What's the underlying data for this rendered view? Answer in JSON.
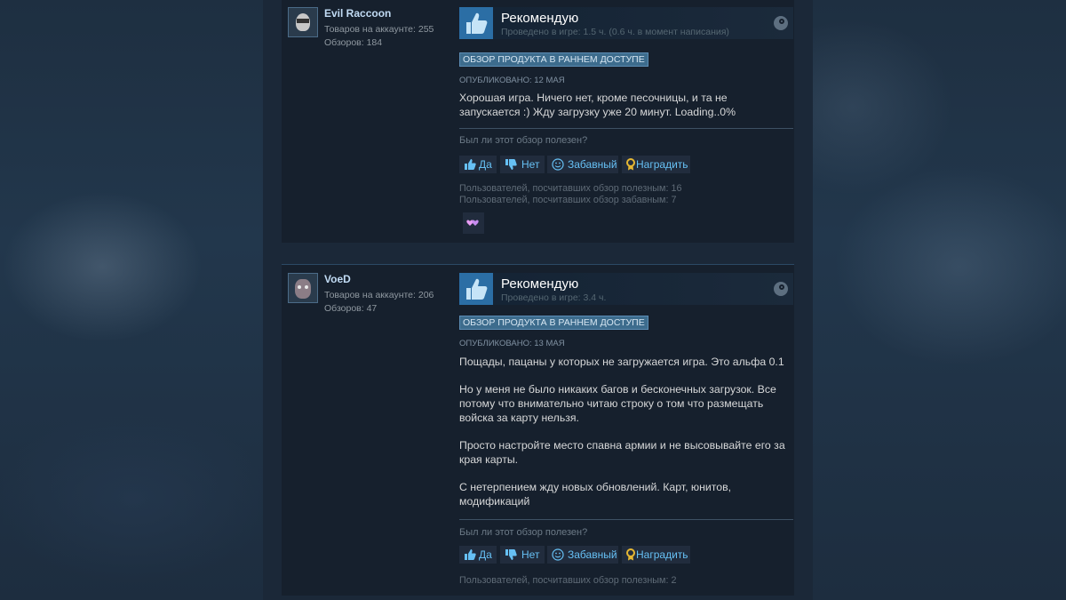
{
  "reviews": [
    {
      "author": {
        "name": "Evil Raccoon",
        "products": "Товаров на аккаунте: 255",
        "reviews": "Обзоров: 184"
      },
      "recommend_label": "Рекомендую",
      "hours": "Проведено в игре: 1.5 ч. (0.6 ч. в момент написания)",
      "badge": "ОБЗОР ПРОДУКТА В РАННЕМ ДОСТУПЕ",
      "posted": "ОПУБЛИКОВАНО: 12 МАЯ",
      "paragraphs": [
        "Хорошая игра. Ничего нет, кроме песочницы, и та не запускается :) Жду загрузку уже 20 минут. Loading..0%"
      ],
      "helpful_question": "Был ли этот обзор полезен?",
      "buttons": {
        "yes": "Да",
        "no": "Нет",
        "funny": "Забавный",
        "award": "Наградить"
      },
      "stats": {
        "helpful": "Пользователей, посчитавших обзор полезным: 16",
        "funny": "Пользователей, посчитавших обзор забавным: 7"
      }
    },
    {
      "author": {
        "name": "VoeD",
        "products": "Товаров на аккаунте: 206",
        "reviews": "Обзоров: 47"
      },
      "recommend_label": "Рекомендую",
      "hours": "Проведено в игре: 3.4 ч.",
      "badge": "ОБЗОР ПРОДУКТА В РАННЕМ ДОСТУПЕ",
      "posted": "ОПУБЛИКОВАНО: 13 МАЯ",
      "paragraphs": [
        "Пощады, пацаны у которых не загружается игра. Это альфа 0.1",
        "Но у меня не было никаких багов и бесконечных загрузок. Все потому что внимательно читаю строку о том что размещать войска за карту нельзя.",
        "Просто настройте место спавна армии и не высовывайте его за края карты.",
        "С нетерпением жду новых обновлений. Карт, юнитов, модификаций"
      ],
      "helpful_question": "Был ли этот обзор полезен?",
      "buttons": {
        "yes": "Да",
        "no": "Нет",
        "funny": "Забавный",
        "award": "Наградить"
      },
      "stats": {
        "helpful": "Пользователей, посчитавших обзор полезным: 2"
      }
    }
  ],
  "colors": {
    "link_blue": "#66c0f4",
    "thumb_bg": "#2b6ea5",
    "badge_bg": "#3d6c8d",
    "award_gold": "#e5b733"
  }
}
